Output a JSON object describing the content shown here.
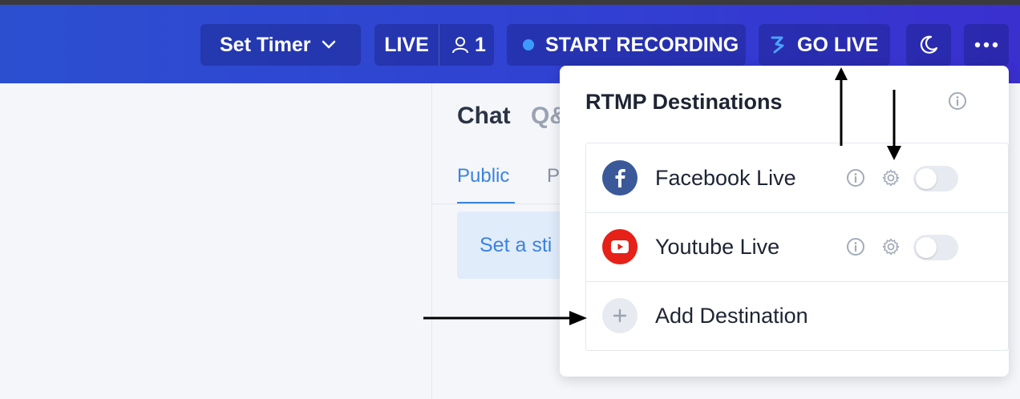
{
  "header": {
    "timer_label": "Set Timer",
    "live_label": "LIVE",
    "viewer_count": "1",
    "record_label": "START RECORDING",
    "golive_label": "GO LIVE",
    "colors": {
      "header_start": "#2c4fd0",
      "header_end": "#3a2fcf",
      "record_dot": "#3d9bff"
    }
  },
  "side_panel": {
    "tabs": [
      "Chat",
      "Q&A"
    ],
    "sub_tabs": [
      "Public",
      "Private"
    ],
    "visible_chat": "Chat",
    "visible_qa": "Q&",
    "visible_public": "Public",
    "visible_private": "P",
    "sticky_placeholder": "Set a sti"
  },
  "rtmp": {
    "title": "RTMP Destinations",
    "destinations": [
      {
        "label": "Facebook Live",
        "icon": "facebook-icon",
        "brand_color": "#3b5998",
        "enabled": false
      },
      {
        "label": "Youtube Live",
        "icon": "youtube-icon",
        "brand_color": "#e62117",
        "enabled": false
      }
    ],
    "add_label": "Add Destination"
  }
}
